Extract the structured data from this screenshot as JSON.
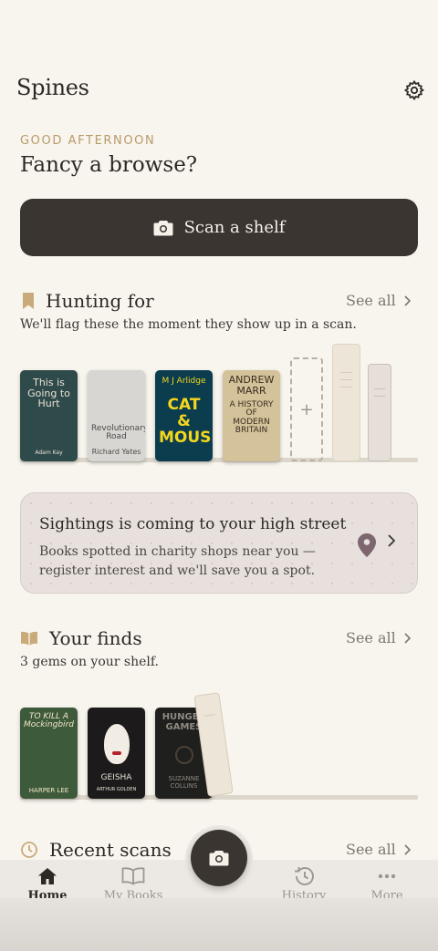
{
  "app": {
    "title": "Spines"
  },
  "greeting": {
    "eyebrow": "GOOD AFTERNOON",
    "headline": "Fancy a browse?"
  },
  "scan_button": {
    "label": "Scan a shelf"
  },
  "hunting": {
    "title": "Hunting for",
    "see_all": "See all",
    "subtitle": "We'll flag these the moment they show up in a scan.",
    "books": [
      {
        "title": "This is Going to Hurt",
        "author": "Adam Kay",
        "bg": "#2f4a4a",
        "fg": "#e9e2d4"
      },
      {
        "title": "Revolutionary Road",
        "author": "Richard Yates",
        "bg": "#d8d6d2",
        "fg": "#4a4a4a"
      },
      {
        "title": "CAT & MOUSE",
        "author": "M J Arlidge",
        "bg": "#0c3d4f",
        "fg": "#f4d71c"
      },
      {
        "title": "A HISTORY OF MODERN BRITAIN",
        "author": "ANDREW MARR",
        "bg": "#d4c29a",
        "fg": "#3b2b1f"
      }
    ],
    "add_symbol": "+"
  },
  "sightings": {
    "title": "Sightings is coming to your high street",
    "body": "Books spotted in charity shops near you — register interest and we'll save you a spot."
  },
  "finds": {
    "title": "Your finds",
    "see_all": "See all",
    "subtitle": "3 gems on your shelf.",
    "books": [
      {
        "title": "TO KILL A Mockingbird",
        "author": "HARPER LEE",
        "bg": "#3d5a3a",
        "fg": "#f3e7c9"
      },
      {
        "title": "GEISHA",
        "author": "ARTHUR GOLDEN",
        "bg": "#1c1a1a",
        "fg": "#e8e1d8"
      },
      {
        "title": "HUNGER GAMES",
        "author": "SUZANNE COLLINS",
        "bg": "#1f1f1d",
        "fg": "#8f8a82"
      }
    ]
  },
  "recent": {
    "title": "Recent scans",
    "see_all": "See all"
  },
  "nav": {
    "items": [
      {
        "label": "Home",
        "icon": "home-icon"
      },
      {
        "label": "My Books",
        "icon": "open-book-icon"
      },
      {
        "label": "History",
        "icon": "history-icon"
      },
      {
        "label": "More",
        "icon": "more-dots-icon"
      }
    ]
  },
  "colors": {
    "accent": "#b99a6a",
    "dark": "#3a3531",
    "background": "#f8f5ee"
  }
}
